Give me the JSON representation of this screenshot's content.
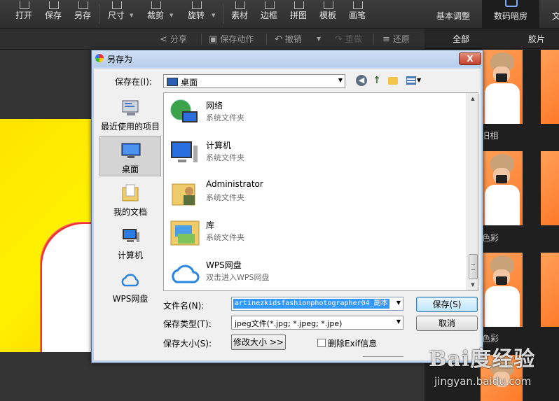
{
  "toolbar": {
    "items": [
      "打开",
      "保存",
      "另存",
      "尺寸",
      "裁剪",
      "旋转",
      "素材",
      "边框",
      "拼图",
      "模板",
      "画笔"
    ],
    "right_tabs": [
      "基本调整",
      "数码暗房",
      "文"
    ]
  },
  "toolbar2": {
    "share": "分享",
    "save_action": "保存动作",
    "undo": "撤销",
    "redo": "重做",
    "restore": "还原"
  },
  "right_panel": {
    "tabs": [
      "全部",
      "胶片"
    ],
    "labels": [
      "l旧相",
      "色彩",
      "色彩"
    ]
  },
  "dialog": {
    "title": "另存为",
    "close": "X",
    "save_in_label": "保存在(I):",
    "save_in_value": "桌面",
    "places": [
      "最近使用的项目",
      "桌面",
      "我的文档",
      "计算机",
      "WPS网盘"
    ],
    "files": [
      {
        "name": "网络",
        "type": "系统文件夹"
      },
      {
        "name": "计算机",
        "type": "系统文件夹"
      },
      {
        "name": "Administrator",
        "type": "系统文件夹"
      },
      {
        "name": "库",
        "type": "系统文件夹"
      },
      {
        "name": "WPS网盘",
        "type": "双击进入WPS网盘"
      }
    ],
    "filename_label": "文件名(N):",
    "filename_value": "artinezkidsfashionphotographer04_副本",
    "filetype_label": "保存类型(T):",
    "filetype_value": "jpeg文件(*.jpg; *.jpeg; *.jpe)",
    "filesize_label": "保存大小(S):",
    "resize_button": "修改大小 >>",
    "exif_label": "删除Exif信息",
    "exif_checked": false,
    "save_button": "保存(S)",
    "cancel_button": "取消"
  },
  "watermark": {
    "big": "Bai度经验",
    "small": "jingyan.baidu.com"
  }
}
